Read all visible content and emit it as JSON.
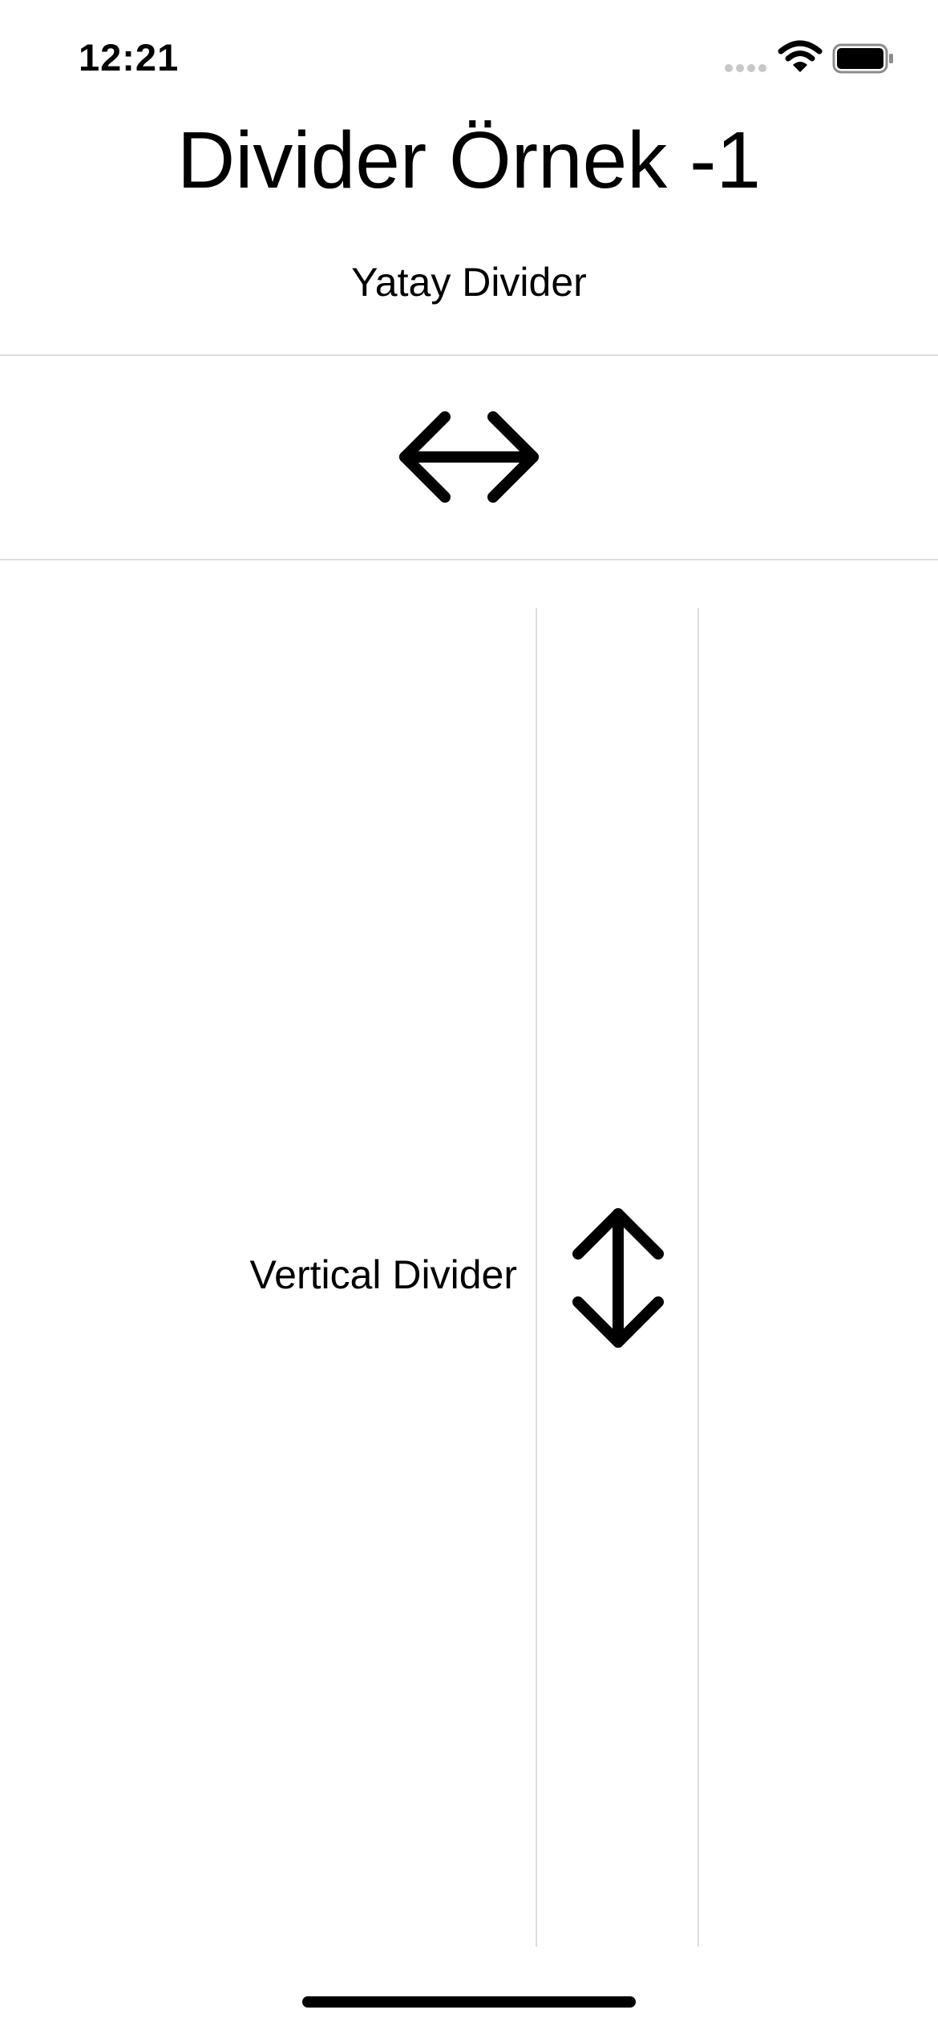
{
  "status_bar": {
    "time": "12:21",
    "icons": [
      "signal-icon",
      "wifi-icon",
      "battery-icon"
    ]
  },
  "title": "Divider Örnek -1",
  "horizontal_section": {
    "label": "Yatay Divider",
    "icon": "left-right-arrow-icon"
  },
  "vertical_section": {
    "label": "Vertical Divider",
    "icon": "up-down-arrow-icon"
  },
  "colors": {
    "divider": "#dcdcdc",
    "text": "#000000",
    "background": "#ffffff"
  }
}
